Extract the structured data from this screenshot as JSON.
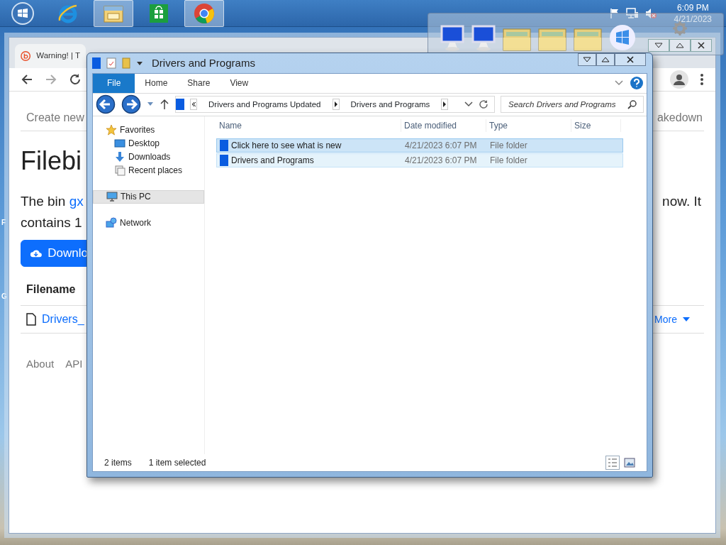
{
  "taskbar": {
    "items": [
      {
        "kind": "start",
        "active": false
      },
      {
        "kind": "ie",
        "active": false
      },
      {
        "kind": "explorer",
        "active": true
      },
      {
        "kind": "store",
        "active": false
      },
      {
        "kind": "chrome",
        "active": true
      }
    ],
    "time": "6:09 PM",
    "date": "4/21/2023"
  },
  "desktop_labels": [
    "F",
    "G"
  ],
  "browser": {
    "tab": {
      "title": "Warning! | T"
    },
    "nav_left": "Create new",
    "nav_right": "akedown",
    "heading": "Filebi",
    "intro": "The bin ",
    "intro_link": "gx",
    "intro_right": "now. It",
    "intro_line2": "contains 1",
    "download_button": "Downlo",
    "table_header": "Filename",
    "file_link": "Drivers_",
    "more_link": "More",
    "footer_links": [
      "About",
      "API"
    ]
  },
  "explorer": {
    "title": "Drivers and Programs",
    "ribbon_tabs": [
      {
        "label": "File",
        "kind": "menu"
      },
      {
        "label": "Home",
        "kind": "tab"
      },
      {
        "label": "Share",
        "kind": "tab"
      },
      {
        "label": "View",
        "kind": "tab"
      }
    ],
    "breadcrumb": [
      "Drivers and Programs Updated",
      "Drivers and Programs"
    ],
    "search": {
      "placeholder": "Search Drivers and Programs"
    },
    "nav": [
      {
        "label": "Favorites",
        "kind": "star",
        "selected": false,
        "children": [
          {
            "label": "Desktop",
            "kind": "desktop",
            "selected": false
          },
          {
            "label": "Downloads",
            "kind": "download",
            "selected": false
          },
          {
            "label": "Recent places",
            "kind": "recent",
            "selected": false
          }
        ]
      },
      {
        "label": "This PC",
        "kind": "pc",
        "selected": true
      },
      {
        "label": "Network",
        "kind": "network",
        "selected": false
      }
    ],
    "columns": [
      "Name",
      "Date modified",
      "Type",
      "Size"
    ],
    "rows": [
      {
        "name": "Click here to see what is new",
        "date": "4/21/2023 6:07 PM",
        "type": "File folder",
        "selected": true,
        "hovered": false
      },
      {
        "name": "Drivers and Programs",
        "date": "4/21/2023 6:07 PM",
        "type": "File folder",
        "selected": false,
        "hovered": true
      }
    ],
    "status": {
      "count": "2 items",
      "selection": "1 item selected"
    }
  }
}
